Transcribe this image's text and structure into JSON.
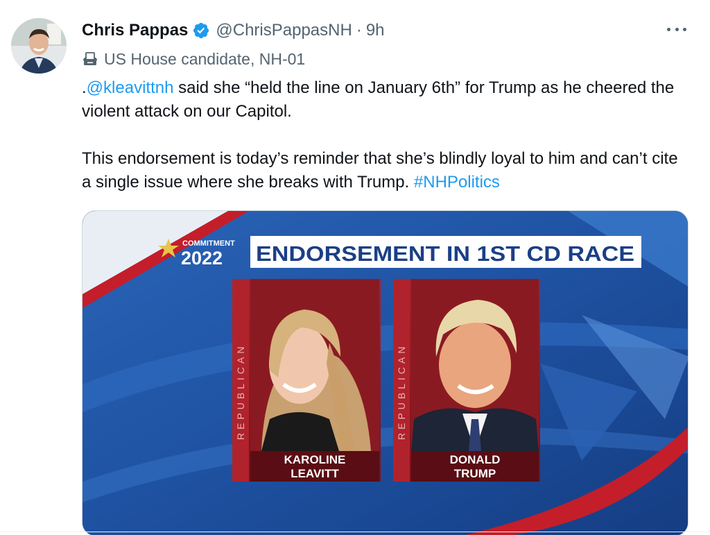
{
  "author": {
    "display_name": "Chris Pappas",
    "handle": "@ChrisPappasNH",
    "separator": "·",
    "time": "9h",
    "label": "US House candidate, NH-01"
  },
  "tweet": {
    "line1_prefix": ".",
    "mention": "@kleavittnh",
    "line1_rest": " said she “held the line on January 6th” for Trump as he cheered the violent attack on our Capitol.",
    "para2": "This endorsement is today’s reminder that she’s blindly loyal to him and can’t cite a single issue where she breaks with Trump. ",
    "hashtag": "#NHPolitics"
  },
  "media": {
    "logo_top": "COMMITMENT",
    "logo_year": "2022",
    "headline": "ENDORSEMENT IN 1ST CD RACE",
    "left_party": "REPUBLICAN",
    "left_name_1": "KAROLINE",
    "left_name_2": "LEAVITT",
    "right_party": "REPUBLICAN",
    "right_name_1": "DONALD",
    "right_name_2": "TRUMP"
  },
  "icons": {
    "verified": "verified-badge-icon",
    "more": "more-options-icon",
    "label": "ballot-box-icon"
  },
  "colors": {
    "link": "#1d9bf0",
    "verified": "#1d9bf0",
    "secondary_text": "#536471",
    "primary_text": "#0f1419"
  }
}
